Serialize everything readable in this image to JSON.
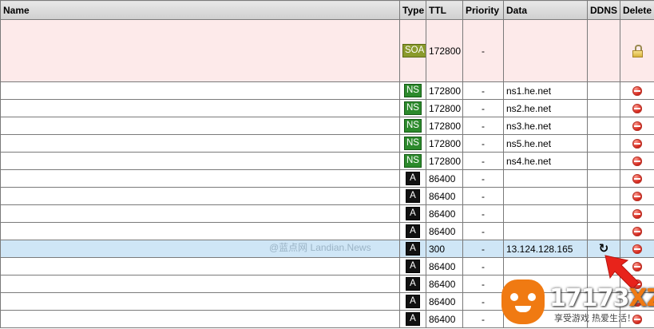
{
  "columns": {
    "name": "Name",
    "type": "Type",
    "ttl": "TTL",
    "priority": "Priority",
    "data": "Data",
    "ddns": "DDNS",
    "delete": "Delete"
  },
  "soa": {
    "type": "SOA",
    "ttl": "172800",
    "priority": "-"
  },
  "records": [
    {
      "type": "NS",
      "ttl": "172800",
      "priority": "-",
      "data": "ns1.he.net"
    },
    {
      "type": "NS",
      "ttl": "172800",
      "priority": "-",
      "data": "ns2.he.net"
    },
    {
      "type": "NS",
      "ttl": "172800",
      "priority": "-",
      "data": "ns3.he.net"
    },
    {
      "type": "NS",
      "ttl": "172800",
      "priority": "-",
      "data": "ns5.he.net"
    },
    {
      "type": "NS",
      "ttl": "172800",
      "priority": "-",
      "data": "ns4.he.net"
    },
    {
      "type": "A",
      "ttl": "86400",
      "priority": "-",
      "data": ""
    },
    {
      "type": "A",
      "ttl": "86400",
      "priority": "-",
      "data": ""
    },
    {
      "type": "A",
      "ttl": "86400",
      "priority": "-",
      "data": ""
    },
    {
      "type": "A",
      "ttl": "86400",
      "priority": "-",
      "data": ""
    },
    {
      "type": "A",
      "ttl": "300",
      "priority": "-",
      "data": "13.124.128.165"
    },
    {
      "type": "A",
      "ttl": "86400",
      "priority": "-",
      "data": ""
    },
    {
      "type": "A",
      "ttl": "86400",
      "priority": "-",
      "data": ""
    },
    {
      "type": "A",
      "ttl": "86400",
      "priority": "-",
      "data": ""
    },
    {
      "type": "A",
      "ttl": "86400",
      "priority": "-",
      "data": ""
    }
  ],
  "watermark": "@蓝点网 Landian.News",
  "logo": {
    "brand_digits": "17173",
    "brand_suffix": "XZ",
    "slogan": "享受游戏 热爱生活！"
  },
  "colors": {
    "soa_row_bg": "#fdeaea",
    "highlight_row_bg": "#cfe6f6",
    "ns_badge": "#2c8a2c",
    "soa_badge": "#8a9a2c",
    "a_badge": "#111111",
    "arrow": "#e8231b",
    "logo_orange": "#f07a12"
  },
  "icons": {
    "soa_delete": "lock-icon",
    "record_delete": "delete-icon",
    "ddns": "refresh-icon"
  }
}
